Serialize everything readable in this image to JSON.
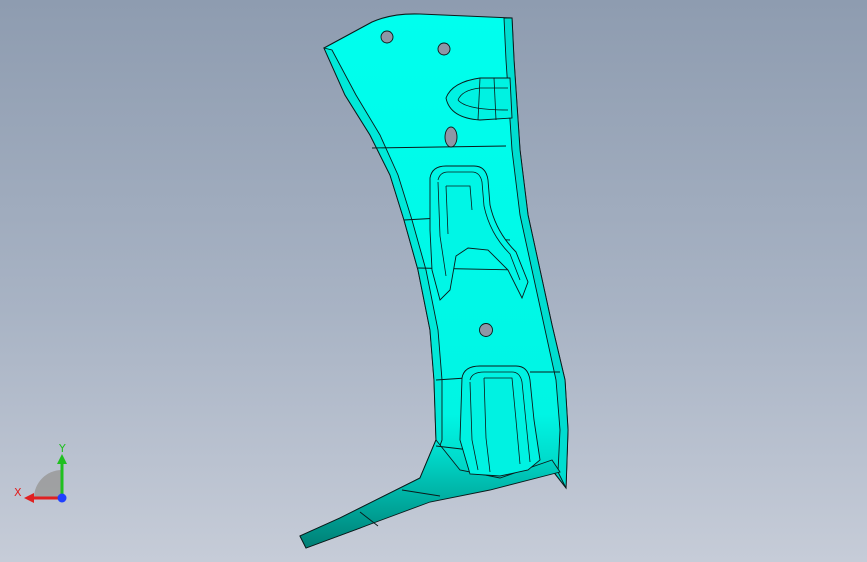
{
  "viewport": {
    "background_top": "#8e9cb0",
    "background_bottom": "#c6ccd8"
  },
  "model": {
    "part_color": "#00ffee",
    "edge_color": "#0a1a1a",
    "hole_color": "#8d97a6"
  },
  "triad": {
    "x_label": "X",
    "y_label": "Y",
    "x_color": "#e02020",
    "y_color": "#20c020",
    "z_color": "#2040ff"
  }
}
